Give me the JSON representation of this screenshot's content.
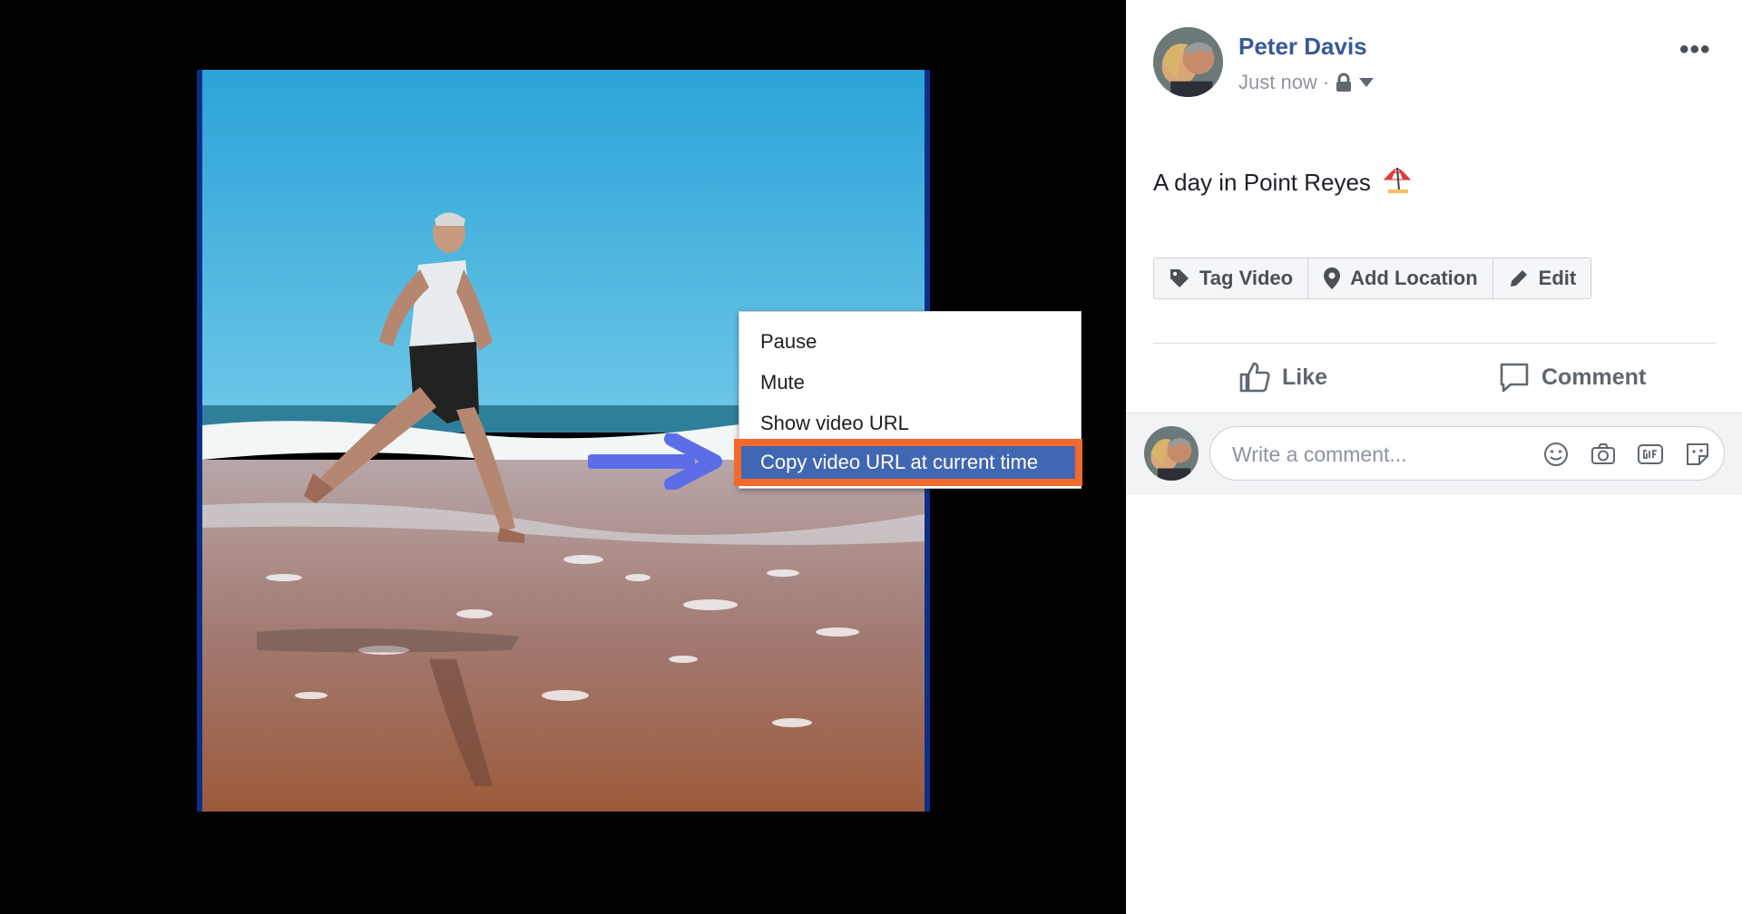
{
  "context_menu": {
    "items": [
      "Pause",
      "Mute",
      "Show video URL"
    ],
    "highlighted": "Copy video URL at current time"
  },
  "post": {
    "author": "Peter Davis",
    "time": "Just now ·",
    "text": "A day in Point Reyes"
  },
  "tag_bar": {
    "tag_video": "Tag Video",
    "add_location": "Add Location",
    "edit": "Edit"
  },
  "actions": {
    "like": "Like",
    "comment": "Comment"
  },
  "comment_box": {
    "placeholder": "Write a comment..."
  },
  "colors": {
    "author": "#385898",
    "menu_highlight": "#4267b2",
    "highlight_border": "#f26a2e",
    "arrow": "#5b6ee8"
  },
  "icons": [
    "lock-icon",
    "caret-down-icon",
    "more-icon",
    "umbrella-icon",
    "tag-icon",
    "location-pin-icon",
    "pencil-icon",
    "thumbs-up-icon",
    "comment-icon",
    "emoji-icon",
    "camera-icon",
    "gif-icon",
    "sticker-icon"
  ]
}
